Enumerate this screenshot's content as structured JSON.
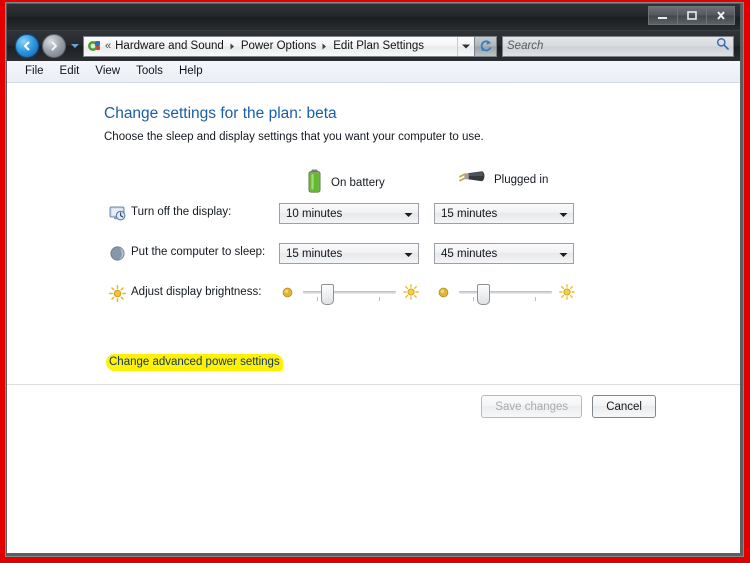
{
  "window": {
    "controls": {
      "minimize": "minimize-icon",
      "maximize": "maximize-icon",
      "close": "close-icon"
    }
  },
  "navigation": {
    "back_icon": "back-arrow-icon",
    "forward_icon": "forward-arrow-icon",
    "recent_pages_icon": "chevron-down-icon",
    "refresh_icon": "refresh-icon"
  },
  "breadcrumb": {
    "folder_icon": "control-panel-icon",
    "overflow": "«",
    "items": [
      {
        "label": "Hardware and Sound"
      },
      {
        "label": "Power Options"
      },
      {
        "label": "Edit Plan Settings"
      }
    ],
    "dropdown_icon": "chevron-down-icon"
  },
  "search": {
    "placeholder": "Search",
    "icon": "search-icon"
  },
  "menubar": {
    "items": [
      {
        "label": "File"
      },
      {
        "label": "Edit"
      },
      {
        "label": "View"
      },
      {
        "label": "Tools"
      },
      {
        "label": "Help"
      }
    ]
  },
  "main": {
    "title": "Change settings for the plan: beta",
    "subtitle": "Choose the sleep and display settings that you want your computer to use.",
    "columns": [
      {
        "label": "On battery",
        "icon": "battery-icon"
      },
      {
        "label": "Plugged in",
        "icon": "power-plug-icon"
      }
    ],
    "settings": [
      {
        "label": "Turn off the display:",
        "icon": "display-clock-icon",
        "on_battery": "10 minutes",
        "plugged_in": "15 minutes"
      },
      {
        "label": "Put the computer to sleep:",
        "icon": "sleep-moon-icon",
        "on_battery": "15 minutes",
        "plugged_in": "45 minutes"
      }
    ],
    "brightness": {
      "label": "Adjust display brightness:",
      "icon": "sun-icon",
      "low_icon": "sun-dim-icon",
      "high_icon": "sun-bright-icon",
      "on_battery_percent": 22,
      "plugged_in_percent": 22
    },
    "advanced_link": "Change advanced power settings"
  },
  "footer": {
    "save_label": "Save changes",
    "save_enabled": false,
    "cancel_label": "Cancel",
    "cancel_enabled": true
  },
  "colors": {
    "capture_border": "#e00000",
    "title_link": "#1b5ea6",
    "highlight": "#fff200",
    "link_text": "#12366b",
    "battery_green": "#5cb531"
  }
}
